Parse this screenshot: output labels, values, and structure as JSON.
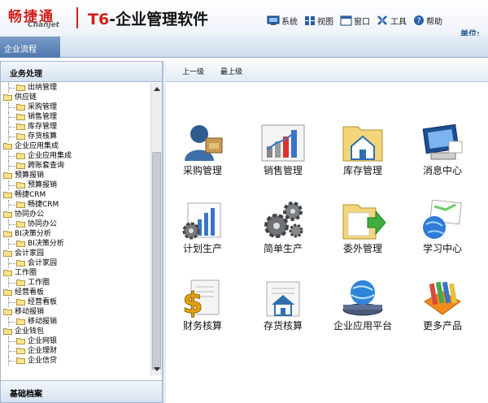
{
  "brand": {
    "cn": "畅捷通",
    "en": "Chanjet"
  },
  "app_title": {
    "prefix": "T6",
    "rest": "-企业管理软件"
  },
  "menu": [
    {
      "label": "系统",
      "icon": "monitor-icon"
    },
    {
      "label": "视图",
      "icon": "view-grid-icon"
    },
    {
      "label": "窗口",
      "icon": "window-icon"
    },
    {
      "label": "工具",
      "icon": "tools-icon"
    },
    {
      "label": "帮助",
      "icon": "help-icon"
    }
  ],
  "unit_label": "单位:",
  "tab": "企业流程",
  "left_panel": {
    "title": "业务处理",
    "bottom_title": "基础档案",
    "tree": [
      {
        "label": "出纳管理",
        "level": 1
      },
      {
        "label": "供应链",
        "level": 0
      },
      {
        "label": "采购管理",
        "level": 1
      },
      {
        "label": "销售管理",
        "level": 1
      },
      {
        "label": "库存管理",
        "level": 1
      },
      {
        "label": "存货核算",
        "level": 1
      },
      {
        "label": "企业应用集成",
        "level": 0
      },
      {
        "label": "企业应用集成",
        "level": 1
      },
      {
        "label": "跨账套查询",
        "level": 1
      },
      {
        "label": "预算报销",
        "level": 0
      },
      {
        "label": "预算报销",
        "level": 1
      },
      {
        "label": "畅捷CRM",
        "level": 0
      },
      {
        "label": "畅捷CRM",
        "level": 1
      },
      {
        "label": "协同办公",
        "level": 0
      },
      {
        "label": "协同办公",
        "level": 1
      },
      {
        "label": "BI决策分析",
        "level": 0
      },
      {
        "label": "BI决策分析",
        "level": 1
      },
      {
        "label": "会计家园",
        "level": 0
      },
      {
        "label": "会计家园",
        "level": 1
      },
      {
        "label": "工作圈",
        "level": 0
      },
      {
        "label": "工作圈",
        "level": 1
      },
      {
        "label": "经营看板",
        "level": 0
      },
      {
        "label": "经营看板",
        "level": 1
      },
      {
        "label": "移动报销",
        "level": 0
      },
      {
        "label": "移动报销",
        "level": 1
      },
      {
        "label": "企业钱包",
        "level": 0
      },
      {
        "label": "企业网银",
        "level": 1
      },
      {
        "label": "企业理财",
        "level": 1
      },
      {
        "label": "企业信贷",
        "level": 1
      }
    ]
  },
  "nav": {
    "up": "上一级",
    "top": "最上级"
  },
  "apps": [
    {
      "label": "采购管理",
      "icon": "purchase-icon"
    },
    {
      "label": "销售管理",
      "icon": "sales-chart-icon"
    },
    {
      "label": "库存管理",
      "icon": "inventory-folder-icon"
    },
    {
      "label": "消息中心",
      "icon": "message-center-icon"
    },
    {
      "label": "计划生产",
      "icon": "plan-production-icon"
    },
    {
      "label": "简单生产",
      "icon": "gears-icon"
    },
    {
      "label": "委外管理",
      "icon": "outsourcing-folder-icon"
    },
    {
      "label": "学习中心",
      "icon": "learning-globe-icon"
    },
    {
      "label": "财务核算",
      "icon": "finance-dollar-icon"
    },
    {
      "label": "存货核算",
      "icon": "stock-house-icon"
    },
    {
      "label": "企业应用平台",
      "icon": "platform-globe-icon"
    },
    {
      "label": "更多产品",
      "icon": "more-products-icon"
    }
  ]
}
